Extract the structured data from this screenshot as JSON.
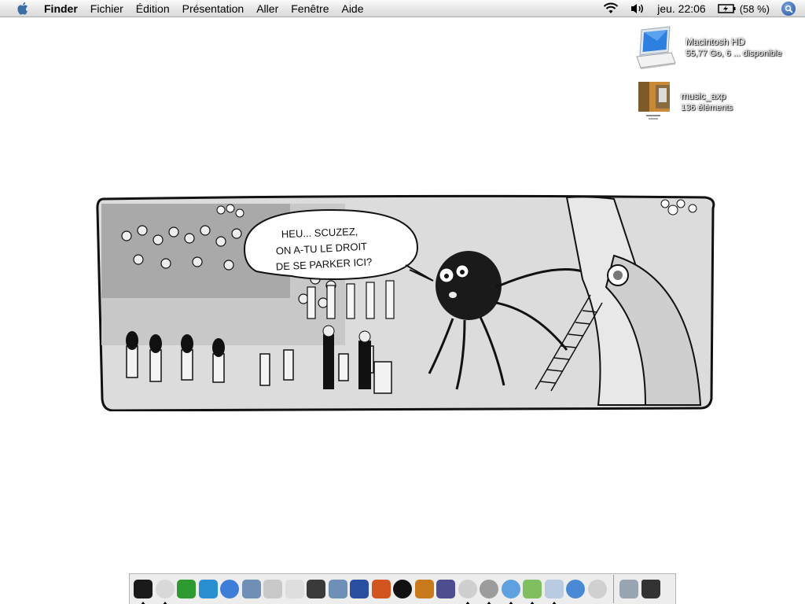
{
  "menubar": {
    "apple_icon": "apple-icon",
    "app_name": "Finder",
    "menus": [
      "Fichier",
      "Édition",
      "Présentation",
      "Aller",
      "Fenêtre",
      "Aide"
    ],
    "clock": "jeu. 22:06",
    "battery_percent": "(58 %)",
    "status_icons": [
      "wifi-icon",
      "volume-icon",
      "battery-icon",
      "spotlight-icon"
    ]
  },
  "desktop": {
    "icons": [
      {
        "name": "Macintosh HD",
        "detail": "55,77 Go, 6 ... disponible",
        "icon": "hard-drive-icon"
      },
      {
        "name": "music_axp",
        "detail": "136 éléments",
        "icon": "folder-icon"
      }
    ]
  },
  "comic": {
    "speech_bubble": [
      "HEU... SCUZEZ,",
      "ON A-TU LE DROIT",
      "DE SE PARKER ICI?"
    ]
  },
  "dock": {
    "apps": [
      {
        "icon": "x11-icon",
        "color": "#1a1a1a",
        "running": true
      },
      {
        "icon": "clock-icon",
        "color": "#d8d8d8",
        "running": true
      },
      {
        "icon": "leaf-icon",
        "color": "#2f9a2f",
        "running": false
      },
      {
        "icon": "web-editor-icon",
        "color": "#2a8fd0",
        "running": false
      },
      {
        "icon": "quicktime-icon",
        "color": "#3d7fd8",
        "running": false
      },
      {
        "icon": "preview-icon",
        "color": "#6f8fb7",
        "running": false
      },
      {
        "icon": "network-icon",
        "color": "#c9c9c9",
        "running": false
      },
      {
        "icon": "disk-utility-icon",
        "color": "#dedede",
        "running": false
      },
      {
        "icon": "microphone-icon",
        "color": "#3a3a3a",
        "running": false
      },
      {
        "icon": "sound-editor-icon",
        "color": "#6f8fb7",
        "running": false
      },
      {
        "icon": "headphones-icon",
        "color": "#2a4fa0",
        "running": false
      },
      {
        "icon": "reason-icon",
        "color": "#d2551f",
        "running": false
      },
      {
        "icon": "live-icon",
        "color": "#111111",
        "running": false
      },
      {
        "icon": "photo-app-icon",
        "color": "#c97a1c",
        "running": false
      },
      {
        "icon": "picture-frame-icon",
        "color": "#4d4d90",
        "running": false
      },
      {
        "icon": "gears-icon",
        "color": "#cfcfcf",
        "running": true
      },
      {
        "icon": "chat-bubble-icon",
        "color": "#9c9c9c",
        "running": true
      },
      {
        "icon": "compass-icon",
        "color": "#5ea0e0",
        "running": true
      },
      {
        "icon": "music-note-icon",
        "color": "#7fbf5f",
        "running": true
      },
      {
        "icon": "preview-photos-icon",
        "color": "#b9cbe0",
        "running": true
      },
      {
        "icon": "safari-icon",
        "color": "#4a8ad4",
        "running": false
      },
      {
        "icon": "dvd-icon",
        "color": "#d0d0d0",
        "running": false
      }
    ],
    "right_items": [
      {
        "icon": "applications-folder-icon",
        "color": "#9aa5b3"
      },
      {
        "icon": "trash-icon",
        "color": "#333333"
      }
    ]
  }
}
